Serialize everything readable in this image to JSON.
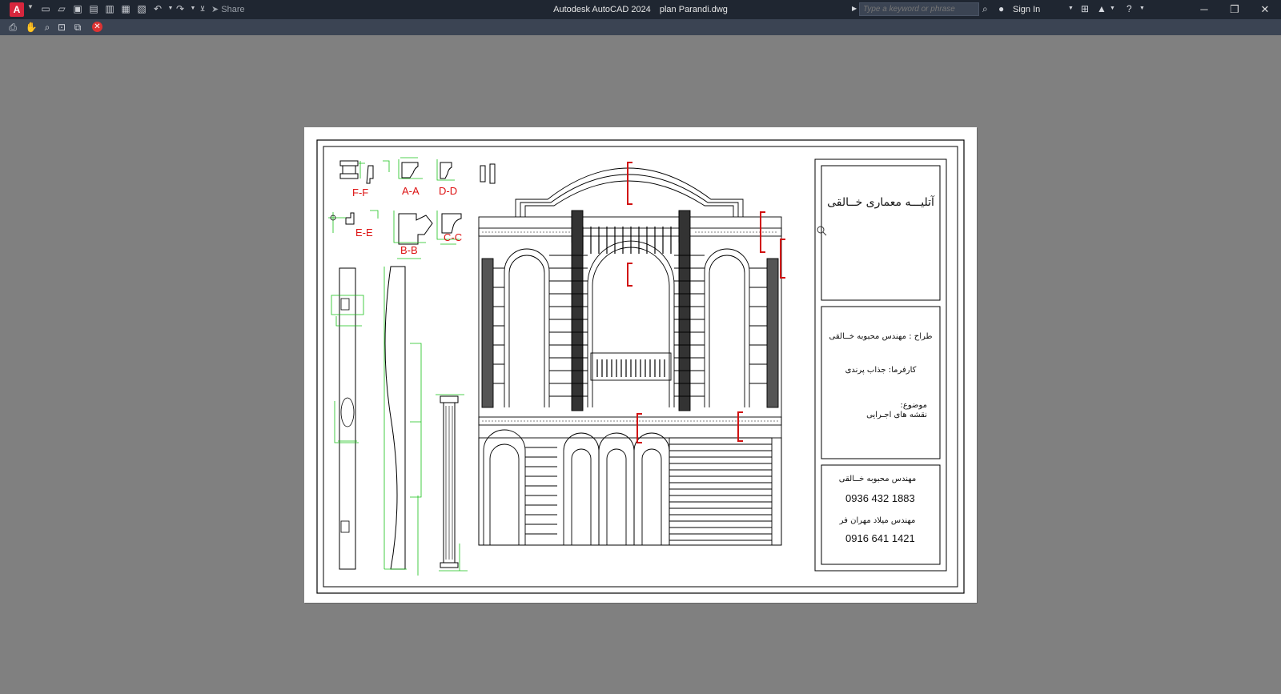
{
  "window": {
    "app_name": "Autodesk AutoCAD 2024",
    "file_name": "plan Parandi.dwg",
    "app_button_label": "A",
    "share_label": "Share",
    "search_placeholder": "Type a keyword or phrase",
    "sign_in_label": "Sign In"
  },
  "quick_access": [
    "new-icon",
    "open-icon",
    "save-icon",
    "save-as-icon",
    "plot-icon",
    "undo-icon",
    "redo-icon"
  ],
  "viewer_toolbar": [
    "print-icon",
    "pan-icon",
    "zoom-icon",
    "zoom-window-icon",
    "zoom-extents-icon",
    "close-icon"
  ],
  "drawing": {
    "section_labels": [
      "F-F",
      "A-A",
      "D-D",
      "E-E",
      "B-B",
      "C-C"
    ],
    "title_block": {
      "studio_name": "آتلیـــه معماری خــالقی",
      "designer": "طراح : مهندس محبوبه خــالقی",
      "client": "کارفرما: جذاب پرندی",
      "subject_label": "موضوع:",
      "subject_value": "نقشه های اجـرایی",
      "engineer_1": "مهندس محبوبه خــالقی",
      "phone_1": "0936 432 1883",
      "engineer_2": "مهندس میلاد مهران فر",
      "phone_2": "0916 641 1421"
    }
  },
  "colors": {
    "title_bar": "#1f2631",
    "toolbar": "#3b4453",
    "canvas": "#808080",
    "dimension_green": "#19c219",
    "section_red": "#d11111"
  }
}
